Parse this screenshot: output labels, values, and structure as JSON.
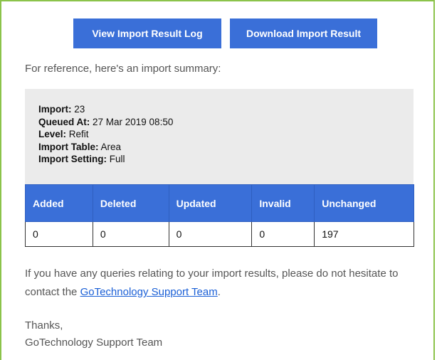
{
  "buttons": {
    "view_log": "View Import Result Log",
    "download": "Download Import Result"
  },
  "intro": "For reference, here's an import summary:",
  "summary": {
    "import_label": "Import:",
    "import_value": " 23",
    "queued_label": "Queued At:",
    "queued_value": " 27 Mar 2019 08:50",
    "level_label": "Level:",
    "level_value": " Refit",
    "table_label": "Import Table:",
    "table_value": " Area",
    "setting_label": "Import Setting:",
    "setting_value": " Full"
  },
  "results_table": {
    "headers": [
      "Added",
      "Deleted",
      "Updated",
      "Invalid",
      "Unchanged"
    ],
    "row": [
      "0",
      "0",
      "0",
      "0",
      "197"
    ]
  },
  "message": {
    "before_link": "If you have any queries relating to your import results, please do not hesitate to contact the ",
    "link_text": "GoTechnology Support Team",
    "after_link": "."
  },
  "signoff": {
    "thanks": "Thanks,",
    "team": "GoTechnology Support Team"
  },
  "colors": {
    "accent": "#3a6fd8",
    "frame": "#8bc34a",
    "summary_bg": "#ebebeb",
    "link": "#1a5fd6"
  }
}
